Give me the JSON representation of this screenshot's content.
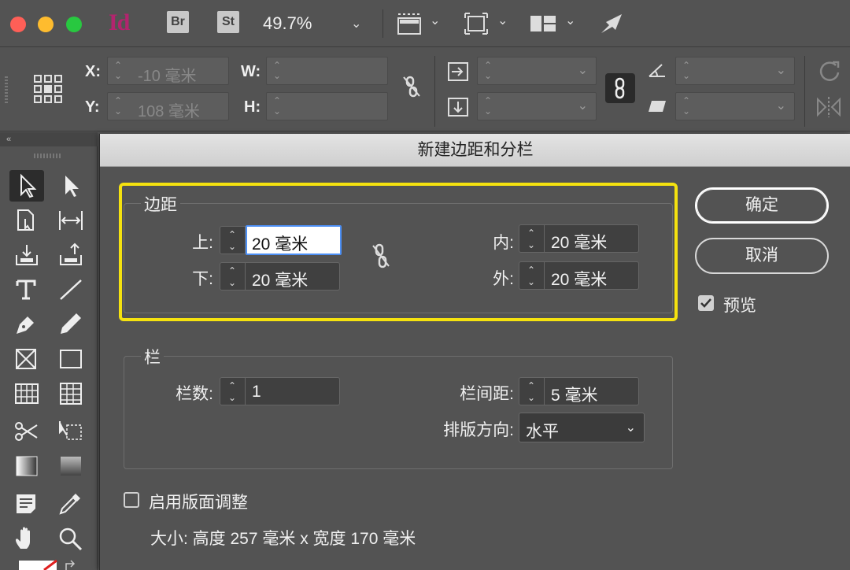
{
  "app": {
    "logo": "Id",
    "bridge_badge": "Br",
    "stock_badge": "St",
    "zoom": "49.7%"
  },
  "control_panel": {
    "x_label": "X:",
    "x_value": "-10 毫米",
    "y_label": "Y:",
    "y_value": "108 毫米",
    "w_label": "W:",
    "h_label": "H:"
  },
  "dialog": {
    "title": "新建边距和分栏",
    "margins": {
      "group_label": "边距",
      "top_label": "上:",
      "top_value": "20 毫米",
      "bottom_label": "下:",
      "bottom_value": "20 毫米",
      "inside_label": "内:",
      "inside_value": "20 毫米",
      "outside_label": "外:",
      "outside_value": "20 毫米"
    },
    "columns": {
      "group_label": "栏",
      "count_label": "栏数:",
      "count_value": "1",
      "gutter_label": "栏间距:",
      "gutter_value": "5 毫米",
      "direction_label": "排版方向:",
      "direction_value": "水平"
    },
    "ok_label": "确定",
    "cancel_label": "取消",
    "preview_label": "预览",
    "preview_checked": true,
    "layout_adjust_label": "启用版面调整",
    "layout_adjust_checked": false,
    "size_text": "大小: 高度 257 毫米 x 宽度 170 毫米"
  },
  "colors": {
    "highlight": "#f5e20f",
    "focus": "#4c8ff5",
    "indesign_brand": "#b3246e"
  }
}
